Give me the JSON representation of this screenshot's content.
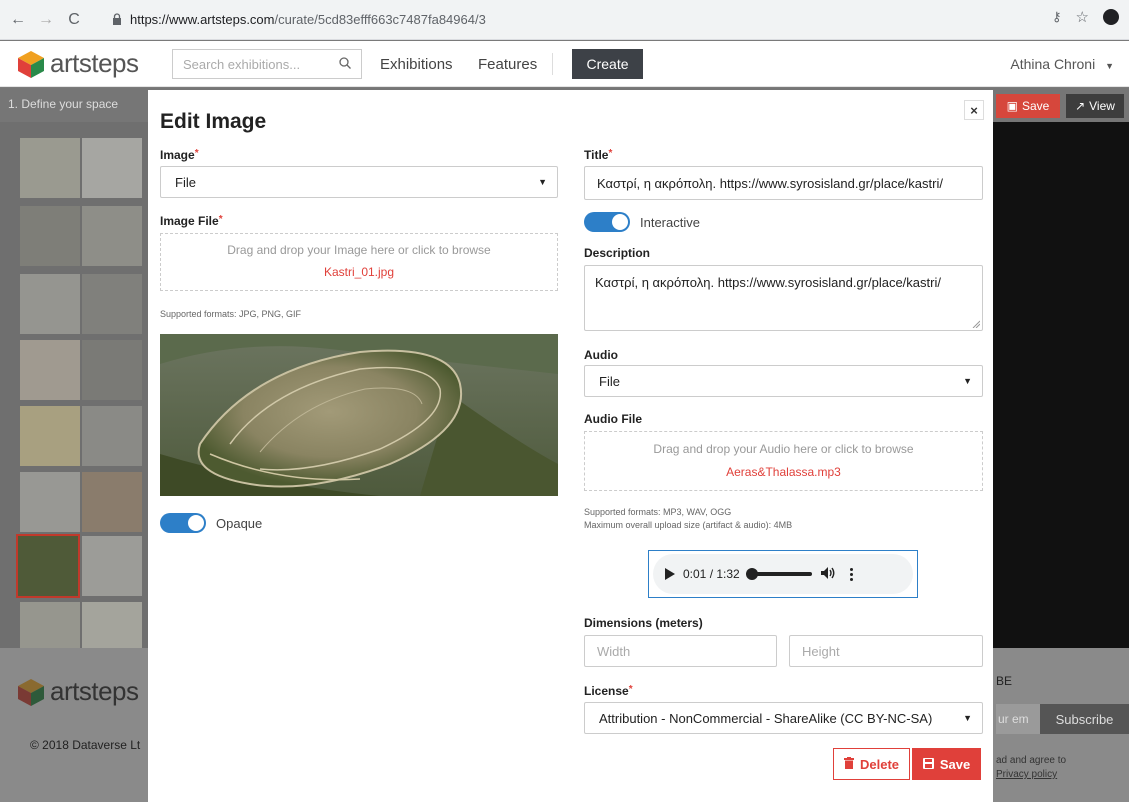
{
  "browser": {
    "url_host": "https://www.artsteps.com",
    "url_path": "/curate/5cd83efff663c7487fa84964/3"
  },
  "header": {
    "logo_text": "artsteps",
    "search_placeholder": "Search exhibitions...",
    "nav_exhibitions": "Exhibitions",
    "nav_features": "Features",
    "create_label": "Create",
    "user_name": "Athina Chroni"
  },
  "background": {
    "step_label": "1. Define your space",
    "save_label": "Save",
    "view_label": "View",
    "footer_logo": "artsteps",
    "footer_copyright": "© 2018 Dataverse Lt",
    "subscribe_heading": "BE",
    "email_placeholder": "ur em",
    "subscribe_label": "Subscribe",
    "agree_text": "ad and agree to",
    "privacy_link": "Privacy policy"
  },
  "modal": {
    "title": "Edit Image",
    "close_glyph": "×",
    "image_label": "Image",
    "image_source": "File",
    "image_file_label": "Image File",
    "image_drop_hint": "Drag and drop your Image here or click to browse",
    "image_file_name": "Kastri_01.jpg",
    "image_formats": "Supported formats: JPG, PNG, GIF",
    "opaque_label": "Opaque",
    "opaque_on": true,
    "title_label": "Title",
    "title_value": "Καστρί, η ακρόπολη. https://www.syrosisland.gr/place/kastri/",
    "interactive_label": "Interactive",
    "interactive_on": true,
    "description_label": "Description",
    "description_value": "Καστρί, η ακρόπολη. https://www.syrosisland.gr/place/kastri/",
    "audio_label": "Audio",
    "audio_source": "File",
    "audio_file_label": "Audio File",
    "audio_drop_hint": "Drag and drop your Audio here or click to browse",
    "audio_file_name": "Aeras&Thalassa.mp3",
    "audio_formats": "Supported formats: MP3, WAV, OGG",
    "audio_max_size": "Maximum overall upload size (artifact & audio): 4MB",
    "audio_time": "0:01 / 1:32",
    "dimensions_label": "Dimensions (meters)",
    "width_placeholder": "Width",
    "height_placeholder": "Height",
    "license_label": "License",
    "license_value": "Attribution - NonCommercial - ShareAlike (CC BY-NC-SA)",
    "delete_label": "Delete",
    "save_label": "Save"
  },
  "colors": {
    "accent_red": "#e0403a",
    "toggle_blue": "#2d7fc8",
    "create_dark": "#3d4147"
  }
}
